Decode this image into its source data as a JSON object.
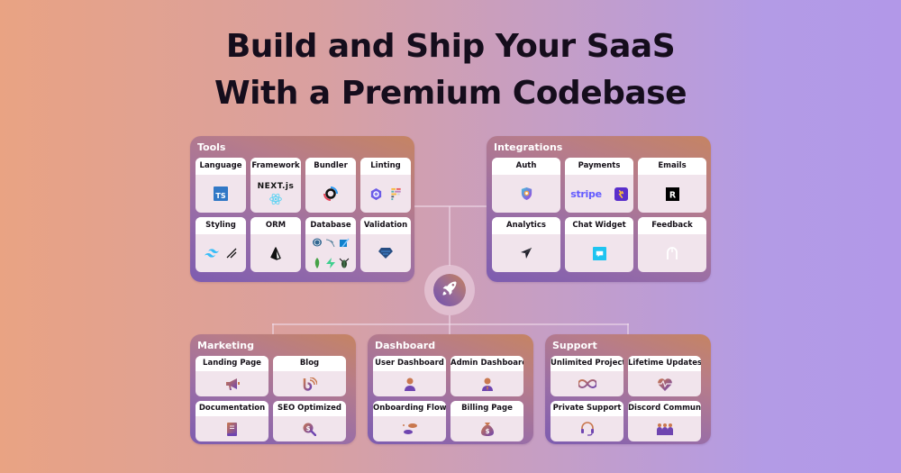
{
  "hero": {
    "title_line1": "Build and Ship Your SaaS",
    "title_line2": "With a Premium Codebase"
  },
  "hub": {
    "icon": "rocket-icon"
  },
  "tools": {
    "title": "Tools",
    "cards": [
      {
        "label": "Language",
        "icons": [
          "typescript-icon"
        ],
        "icon_text": "TS"
      },
      {
        "label": "Framework",
        "icons": [
          "nextjs-icon",
          "react-icon"
        ],
        "icon_text": "NEXT.js"
      },
      {
        "label": "Bundler",
        "icons": [
          "bundler-icon"
        ]
      },
      {
        "label": "Linting",
        "icons": [
          "eslint-icon",
          "prettier-icon"
        ]
      },
      {
        "label": "Styling",
        "icons": [
          "tailwind-icon",
          "shadcn-icon"
        ]
      },
      {
        "label": "ORM",
        "icons": [
          "prisma-icon"
        ]
      },
      {
        "label": "Database",
        "icons": [
          "postgresql-icon",
          "mysql-icon",
          "sqlite-icon",
          "mongodb-icon",
          "supabase-icon",
          "cockroachdb-icon"
        ]
      },
      {
        "label": "Validation",
        "icons": [
          "zod-icon"
        ]
      }
    ]
  },
  "integrations": {
    "title": "Integrations",
    "cards": [
      {
        "label": "Auth",
        "icons": [
          "auth-shield-icon"
        ]
      },
      {
        "label": "Payments",
        "icons": [
          "stripe-icon",
          "lemonsqueezy-icon"
        ],
        "icon_text": "stripe"
      },
      {
        "label": "Emails",
        "icons": [
          "resend-icon"
        ],
        "icon_text": "R"
      },
      {
        "label": "Analytics",
        "icons": [
          "analytics-bird-icon"
        ]
      },
      {
        "label": "Chat Widget",
        "icons": [
          "chat-widget-icon"
        ]
      },
      {
        "label": "Feedback",
        "icons": [
          "feedback-icon"
        ]
      }
    ]
  },
  "marketing": {
    "title": "Marketing",
    "cards": [
      {
        "label": "Landing Page",
        "icons": [
          "megaphone-icon"
        ]
      },
      {
        "label": "Blog",
        "icons": [
          "blog-icon"
        ]
      },
      {
        "label": "Documentation",
        "icons": [
          "book-icon"
        ]
      },
      {
        "label": "SEO Optimized",
        "icons": [
          "seo-search-icon"
        ]
      }
    ]
  },
  "dashboard": {
    "title": "Dashboard",
    "cards": [
      {
        "label": "User Dashboard",
        "icons": [
          "user-icon"
        ]
      },
      {
        "label": "Admin Dashboard",
        "icons": [
          "admin-icon"
        ]
      },
      {
        "label": "Onboarding Flow",
        "icons": [
          "footprints-icon"
        ]
      },
      {
        "label": "Billing Page",
        "icons": [
          "money-bag-icon"
        ]
      }
    ]
  },
  "support": {
    "title": "Support",
    "cards": [
      {
        "label": "Unlimited Projects",
        "icons": [
          "infinity-icon"
        ]
      },
      {
        "label": "Lifetime Updates",
        "icons": [
          "heartbeat-icon"
        ]
      },
      {
        "label": "Private Support",
        "icons": [
          "headset-icon"
        ]
      },
      {
        "label": "Discord Community",
        "icons": [
          "community-icon"
        ]
      }
    ]
  },
  "colors": {
    "background_left": "#e9a383",
    "background_right": "#b298e8",
    "panel_purple": "#7d5cb0",
    "panel_orange": "#c58463",
    "card_body": "#f1e4ec",
    "title_text": "#150d1c",
    "icon_purple": "#7a4fb0",
    "icon_orange": "#c57a52"
  }
}
